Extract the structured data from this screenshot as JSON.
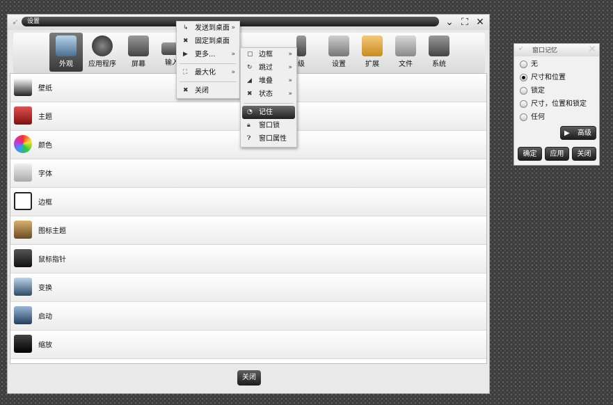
{
  "window": {
    "title": "设置",
    "close_button": "关闭"
  },
  "toolbar": {
    "items": [
      {
        "label": "外观",
        "icon": "appearance-icon",
        "active": true
      },
      {
        "label": "应用程序",
        "icon": "play-icon"
      },
      {
        "label": "屏幕",
        "icon": "monitor-icon"
      },
      {
        "label": "输入",
        "icon": "keyboard-icon"
      },
      {
        "label": "级",
        "icon": "advanced-icon"
      },
      {
        "label": "设置",
        "icon": "wrench-icon"
      },
      {
        "label": "扩展",
        "icon": "puzzle-icon"
      },
      {
        "label": "文件",
        "icon": "folder-icon"
      },
      {
        "label": "系统",
        "icon": "laptop-icon"
      }
    ]
  },
  "list": {
    "items": [
      {
        "label": "壁纸",
        "icon": "wallpaper-icon"
      },
      {
        "label": "主题",
        "icon": "paint-bucket-icon"
      },
      {
        "label": "颜色",
        "icon": "palette-icon"
      },
      {
        "label": "字体",
        "icon": "font-icon"
      },
      {
        "label": "边框",
        "icon": "window-border-icon"
      },
      {
        "label": "图标主题",
        "icon": "icon-theme-icon"
      },
      {
        "label": "鼠标指针",
        "icon": "mouse-pointer-icon"
      },
      {
        "label": "变换",
        "icon": "transition-icon"
      },
      {
        "label": "启动",
        "icon": "startup-icon"
      },
      {
        "label": "缩放",
        "icon": "scale-icon"
      }
    ]
  },
  "context_menu": {
    "items": [
      {
        "label": "发送到桌面",
        "icon": "send-desktop-icon",
        "submenu": true
      },
      {
        "label": "固定到桌面",
        "icon": "pin-icon"
      },
      {
        "label": "更多...",
        "icon": "triangle-right-icon",
        "submenu": true
      },
      {
        "label": "最大化",
        "icon": "maximize-icon",
        "submenu": true
      },
      {
        "label": "关闭",
        "icon": "close-icon"
      }
    ]
  },
  "submenu": {
    "items": [
      {
        "label": "边框",
        "icon": "border-icon",
        "submenu": true
      },
      {
        "label": "跳过",
        "icon": "skip-icon",
        "submenu": true
      },
      {
        "label": "堆叠",
        "icon": "stack-icon",
        "submenu": true
      },
      {
        "label": "状态",
        "icon": "state-icon",
        "submenu": true
      },
      {
        "label": "记住",
        "icon": "remember-icon",
        "highlighted": true
      },
      {
        "label": "窗口锁",
        "icon": "lock-icon"
      },
      {
        "label": "窗口属性",
        "icon": "question-icon"
      }
    ]
  },
  "dialog": {
    "title": "窗口记忆",
    "options": [
      {
        "label": "无",
        "selected": false
      },
      {
        "label": "尺寸和位置",
        "selected": true
      },
      {
        "label": "锁定",
        "selected": false
      },
      {
        "label": "尺寸，位置和锁定",
        "selected": false
      },
      {
        "label": "任何",
        "selected": false
      }
    ],
    "advanced_button": "高级",
    "ok_button": "确定",
    "apply_button": "应用",
    "close_button": "关闭"
  }
}
